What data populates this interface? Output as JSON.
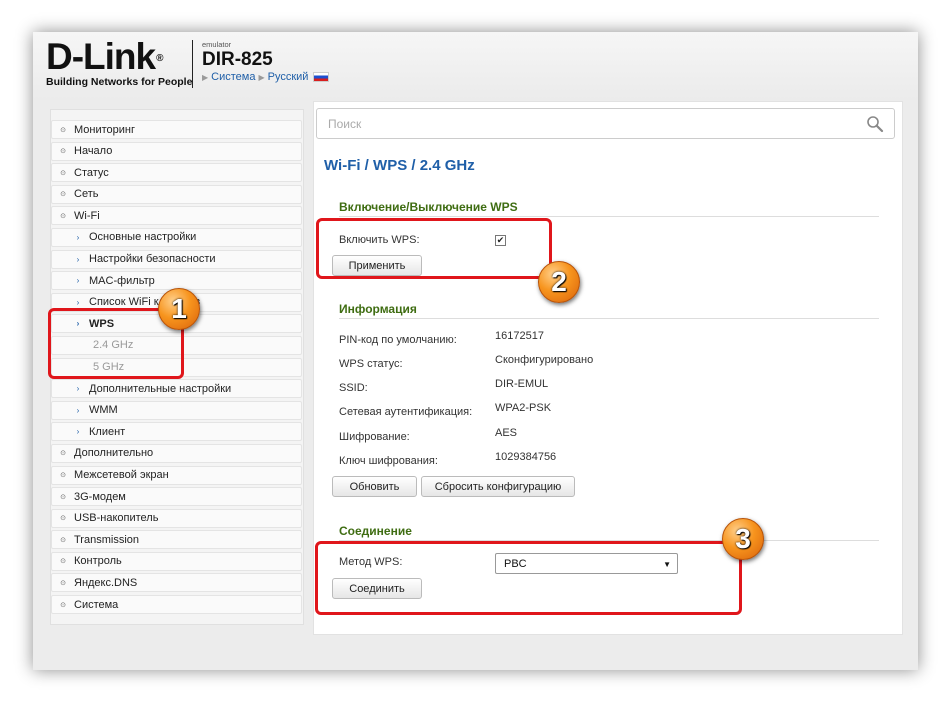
{
  "header": {
    "brand": "D-Link",
    "brand_mark": "®",
    "tagline": "Building Networks for People",
    "emulator_label": "emulator",
    "model": "DIR-825",
    "crumb_system": "Система",
    "crumb_language": "Русский",
    "flag_icon": "russia-flag-icon"
  },
  "sidebar": {
    "items": [
      {
        "label": "Мониторинг"
      },
      {
        "label": "Начало"
      },
      {
        "label": "Статус"
      },
      {
        "label": "Сеть"
      },
      {
        "label": "Wi-Fi"
      },
      {
        "label": "Основные настройки"
      },
      {
        "label": "Настройки безопасности"
      },
      {
        "label": "MAC-фильтр"
      },
      {
        "label": "Список WiFi клиентов"
      },
      {
        "label": "WPS"
      },
      {
        "label": "2.4 GHz"
      },
      {
        "label": "5 GHz"
      },
      {
        "label": "Дополнительные настройки"
      },
      {
        "label": "WMM"
      },
      {
        "label": "Клиент"
      },
      {
        "label": "Дополнительно"
      },
      {
        "label": "Межсетевой экран"
      },
      {
        "label": "3G-модем"
      },
      {
        "label": "USB-накопитель"
      },
      {
        "label": "Transmission"
      },
      {
        "label": "Контроль"
      },
      {
        "label": "Яндекс.DNS"
      },
      {
        "label": "Система"
      }
    ]
  },
  "search": {
    "placeholder": "Поиск"
  },
  "page": {
    "title_part1": "Wi-Fi /",
    "title_part2": "WPS /",
    "title_part3": "2.4 GHz"
  },
  "wps_toggle": {
    "section_title": "Включение/Выключение WPS",
    "enable_label": "Включить WPS:",
    "enabled": true,
    "apply_button": "Применить"
  },
  "info": {
    "section_title": "Информация",
    "rows": [
      {
        "label": "PIN-код по умолчанию:",
        "value": "16172517"
      },
      {
        "label": "WPS статус:",
        "value": "Сконфигурировано"
      },
      {
        "label": "SSID:",
        "value": "DIR-EMUL"
      },
      {
        "label": "Сетевая аутентификация:",
        "value": "WPA2-PSK"
      },
      {
        "label": "Шифрование:",
        "value": "AES"
      },
      {
        "label": "Ключ шифрования:",
        "value": "1029384756"
      }
    ],
    "refresh_button": "Обновить",
    "reset_button": "Сбросить конфигурацию"
  },
  "connection": {
    "section_title": "Соединение",
    "method_label": "Метод WPS:",
    "method_value": "PBC",
    "connect_button": "Соединить"
  },
  "annotations": {
    "badge1": "1",
    "badge2": "2",
    "badge3": "3",
    "highlight_color": "#e0161b",
    "badge_color": "#f7941d"
  },
  "colors": {
    "link_blue": "#1f5fa8",
    "section_green": "#3f6d12"
  }
}
